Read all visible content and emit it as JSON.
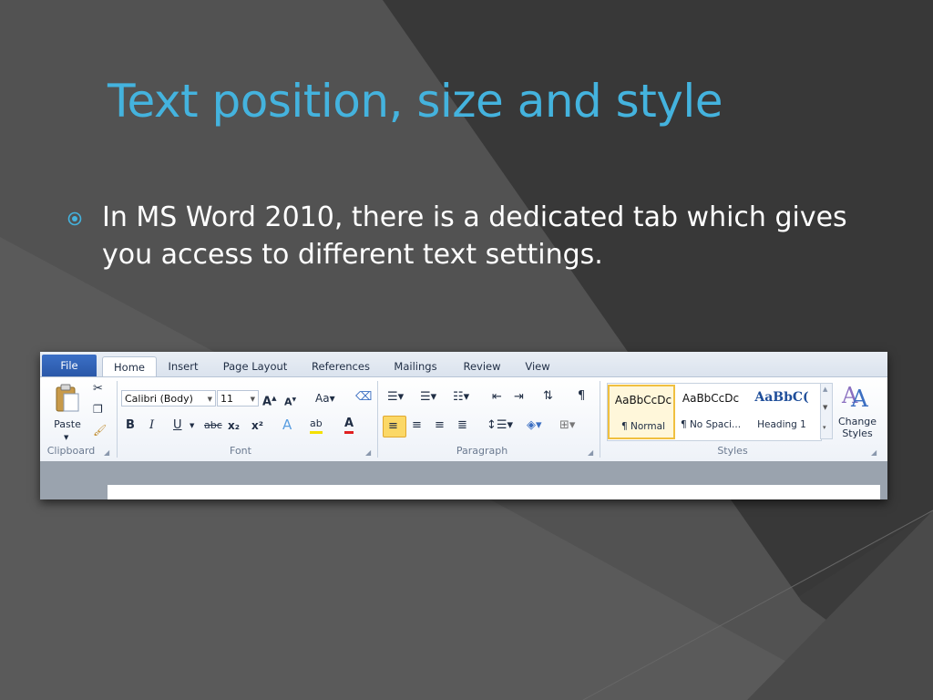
{
  "slide": {
    "title": "Text position, size and style",
    "bullet_text": "In MS Word 2010, there is a dedicated tab which gives you access to different text settings.",
    "title_color": "#44b3de",
    "bullet_icon": "circle-bullet-icon"
  },
  "ribbon": {
    "tabs": [
      "File",
      "Home",
      "Insert",
      "Page Layout",
      "References",
      "Mailings",
      "Review",
      "View"
    ],
    "active_tab": "Home",
    "clipboard": {
      "label": "Clipboard",
      "paste_label": "Paste"
    },
    "font": {
      "label": "Font",
      "font_name": "Calibri (Body)",
      "font_size": "11"
    },
    "paragraph": {
      "label": "Paragraph"
    },
    "styles": {
      "label": "Styles",
      "items": [
        {
          "sample": "AaBbCcDc",
          "name": "¶ Normal"
        },
        {
          "sample": "AaBbCcDc",
          "name": "¶ No Spaci..."
        },
        {
          "sample": "AaBbC(",
          "name": "Heading 1"
        }
      ],
      "change_styles": "Change Styles",
      "change_styles_line1": "Change",
      "change_styles_line2": "Styles"
    }
  }
}
